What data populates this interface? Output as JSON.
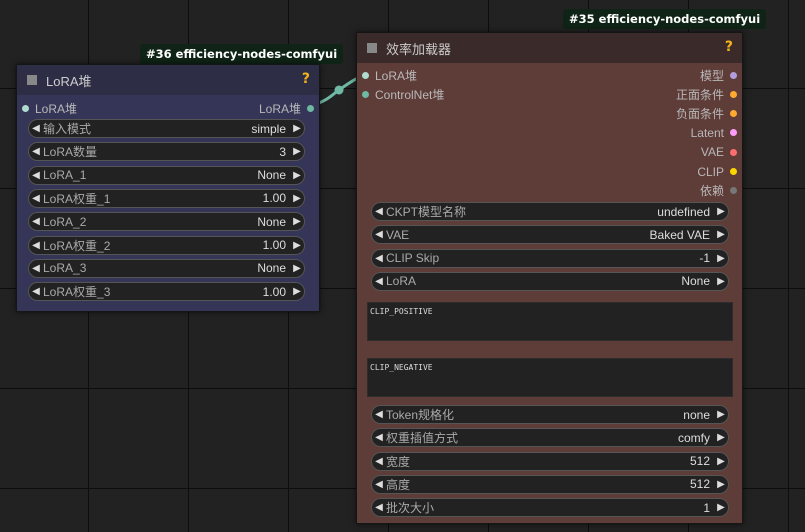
{
  "colors": {
    "lora_node_body": "#343557",
    "lora_node_title": "#2e2d46",
    "loader_node_body": "#5e3c38",
    "loader_node_title": "#3a2a29",
    "link": "#6fb8a3",
    "help": "#f3b51b"
  },
  "lora_node": {
    "badge": "#36 efficiency-nodes-comfyui",
    "title": "LoRA堆",
    "help": "?",
    "input_label": "LoRA堆",
    "output_label": "LoRA堆",
    "widgets": [
      {
        "label": "输入模式",
        "value": "simple"
      },
      {
        "label": "LoRA数量",
        "value": "3"
      },
      {
        "label": "LoRA_1",
        "value": "None"
      },
      {
        "label": "LoRA权重_1",
        "value": "1.00"
      },
      {
        "label": "LoRA_2",
        "value": "None"
      },
      {
        "label": "LoRA权重_2",
        "value": "1.00"
      },
      {
        "label": "LoRA_3",
        "value": "None"
      },
      {
        "label": "LoRA权重_3",
        "value": "1.00"
      }
    ]
  },
  "loader_node": {
    "badge": "#35 efficiency-nodes-comfyui",
    "title": "效率加载器",
    "help": "?",
    "inputs": [
      {
        "label": "LoRA堆"
      },
      {
        "label": "ControlNet堆"
      }
    ],
    "outputs": [
      {
        "label": "模型",
        "color": "#b39ddb"
      },
      {
        "label": "正面条件",
        "color": "#ffa931"
      },
      {
        "label": "负面条件",
        "color": "#ffa931"
      },
      {
        "label": "Latent",
        "color": "#ff9cf9"
      },
      {
        "label": "VAE",
        "color": "#ff6e6e"
      },
      {
        "label": "CLIP",
        "color": "#ffd500"
      },
      {
        "label": "依赖",
        "color": "#777777"
      }
    ],
    "widgets_top": [
      {
        "label": "CKPT模型名称",
        "value": "undefined"
      },
      {
        "label": "VAE",
        "value": "Baked VAE"
      },
      {
        "label": "CLIP Skip",
        "value": "-1"
      },
      {
        "label": "LoRA",
        "value": "None"
      }
    ],
    "clip_positive": "CLIP_POSITIVE",
    "clip_negative": "CLIP_NEGATIVE",
    "widgets_bottom": [
      {
        "label": "Token规格化",
        "value": "none"
      },
      {
        "label": "权重插值方式",
        "value": "comfy"
      },
      {
        "label": "宽度",
        "value": "512"
      },
      {
        "label": "高度",
        "value": "512"
      },
      {
        "label": "批次大小",
        "value": "1"
      }
    ]
  }
}
